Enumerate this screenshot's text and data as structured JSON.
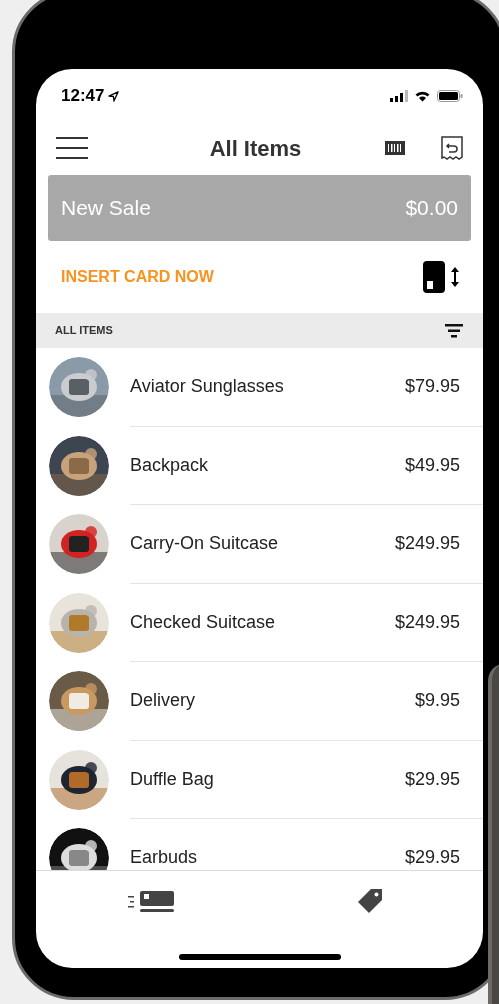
{
  "status_bar": {
    "time": "12:47"
  },
  "header": {
    "title": "All Items"
  },
  "sale_bar": {
    "label": "New Sale",
    "total": "$0.00"
  },
  "card_prompt": {
    "text": "INSERT CARD NOW"
  },
  "section": {
    "title": "ALL ITEMS"
  },
  "items": [
    {
      "name": "Aviator Sunglasses",
      "price": "$79.95"
    },
    {
      "name": "Backpack",
      "price": "$49.95"
    },
    {
      "name": "Carry-On Suitcase",
      "price": "$249.95"
    },
    {
      "name": "Checked Suitcase",
      "price": "$249.95"
    },
    {
      "name": "Delivery",
      "price": "$9.95"
    },
    {
      "name": "Duffle Bag",
      "price": "$29.95"
    },
    {
      "name": "Earbuds",
      "price": "$29.95"
    }
  ]
}
